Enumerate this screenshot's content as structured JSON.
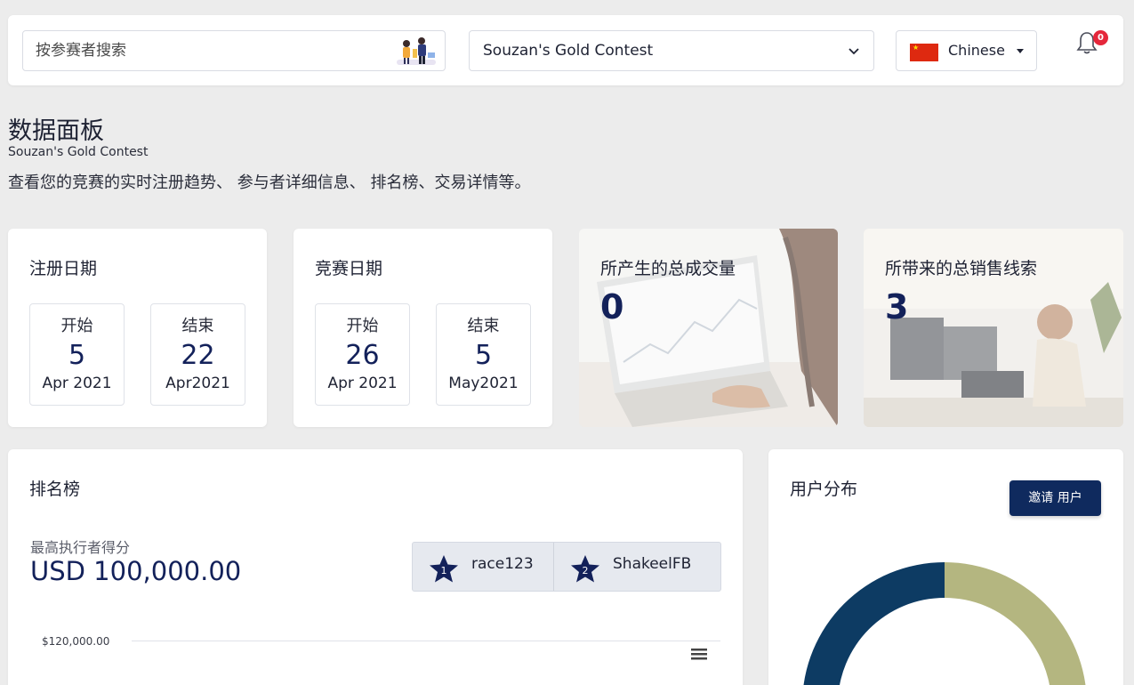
{
  "header": {
    "search_placeholder": "按参赛者搜索",
    "contest_select": "Souzan's Gold Contest",
    "language": "Chinese",
    "notification_count": "0"
  },
  "page": {
    "title": "数据面板",
    "subtitle": "Souzan's Gold Contest",
    "description": "查看您的竞赛的实时注册趋势、 参与者详细信息、 排名榜、交易详情等。"
  },
  "registration": {
    "title": "注册日期",
    "start": {
      "label": "开始",
      "day": "5",
      "month": "Apr 2021"
    },
    "end": {
      "label": "结束",
      "day": "22",
      "month": "Apr2021"
    }
  },
  "contest_dates": {
    "title": "竞赛日期",
    "start": {
      "label": "开始",
      "day": "26",
      "month": "Apr 2021"
    },
    "end": {
      "label": "结束",
      "day": "5",
      "month": "May2021"
    }
  },
  "stats": {
    "trades": {
      "title": "所产生的总成交量",
      "value": "0"
    },
    "leads": {
      "title": "所带来的总销售线索",
      "value": "3"
    }
  },
  "leaderboard": {
    "title": "排名榜",
    "top_label": "最高执行者得分",
    "top_score": "USD 100,000.00",
    "ranks": [
      {
        "rank": "1",
        "name": "race123"
      },
      {
        "rank": "2",
        "name": "ShakeelFB"
      }
    ],
    "y_tick": "$120,000.00"
  },
  "distribution": {
    "title": "用户分布",
    "invite_label": "邀请 用户",
    "colors": {
      "segment_a": "#0d3b63",
      "segment_b": "#b4b680"
    }
  }
}
